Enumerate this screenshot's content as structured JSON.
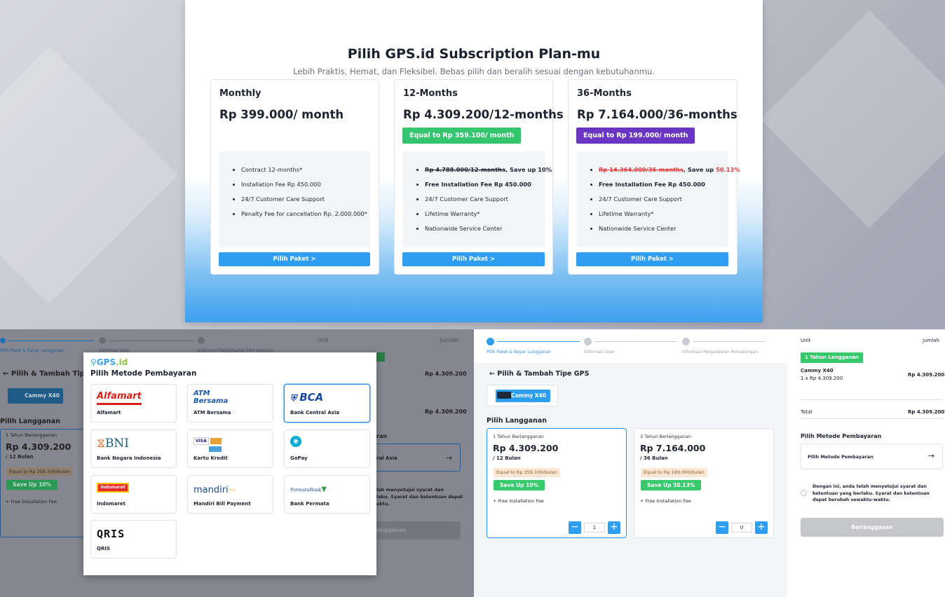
{
  "pricing": {
    "title": "Pilih GPS.id Subscription Plan-mu",
    "subtitle": "Lebih Praktis, Hemat, dan Fleksibel. Bebas pilih dan beralih sesuai dengan kebutuhanmu.",
    "plans": [
      {
        "name": "Monthly",
        "price": "Rp 399.000/ month",
        "equal": "",
        "features": [
          "Contract 12-months*",
          "Installation Fee Rp 450.000",
          "24/7 Customer Care Support",
          "Penalty Fee for cancellation Rp. 2.000.000*"
        ],
        "button": "Pilih Paket >"
      },
      {
        "name": "12-Months",
        "price": "Rp 4.309.200/12-months",
        "equal": "Equal to Rp 359.100/ month",
        "equal_color": "#35c56e",
        "old_price": "Rp 4.788.000/12-months",
        "save": ", Save up 10%",
        "features": [
          "Free Installation Fee Rp 450.000",
          "24/7 Customer Care Support",
          "Lifetime Warranty*",
          "Nationwide Service Center"
        ],
        "button": "Pilih Paket >"
      },
      {
        "name": "36-Months",
        "price": "Rp 7.164.000/36-months",
        "equal": "Equal to Rp 199.000/ month",
        "equal_color": "#6a35c0",
        "old_price": "Rp 14.364.000/36-months",
        "save_prefix": ", Save up ",
        "save_pct": "50.13%",
        "features": [
          "Free Installation Fee Rp 450.000",
          "24/7 Customer Care Support",
          "Lifetime Warranty*",
          "Nationwide Service Center"
        ],
        "button": "Pilih Paket >"
      }
    ]
  },
  "dim_checkout": {
    "step1": "Pilih Paket & Bayar Langganan",
    "step2": "Informasi User",
    "step3": "Informasi Penjadwalan Pemasangan",
    "back_title": "Pilih & Tambah Tipe",
    "device": "Cammy X40",
    "section": "Pilih Langganan",
    "sub_title": "1 Tahun Berlangganan",
    "sub_price": "Rp 4.309.200",
    "sub_unit": "/ 12 Bulan",
    "sub_equal": "Equal to Rp 359.100/bulan",
    "sub_save": "Save Up 10%",
    "sub_fee": "+ Free Installation Fee",
    "unit": "Unit",
    "jumlah": "Jumlah",
    "amount1": "Rp 4.309.200",
    "amount2": "Rp 4.309.200",
    "method_partial": "ran",
    "method_value": "ral Asia",
    "terms_partial1": "lah menyetujui syarat dan",
    "terms_partial2": "laku. Syarat dan ketentuan dapat",
    "terms_partial3": "aktu.",
    "btn_partial": "angganan"
  },
  "modal": {
    "brand": "GPS",
    "brand_suffix": ".id",
    "title": "Pilih Metode Pembayaran",
    "methods": [
      {
        "logo": "Alfamart",
        "name": "Alfamart"
      },
      {
        "logo": "ATM Bersama",
        "name": "ATM Bersama"
      },
      {
        "logo": "BCA",
        "name": "Bank Central Asia"
      },
      {
        "logo": "BNI",
        "name": "Bank Negara Indonesia"
      },
      {
        "logo": "VISA",
        "name": "Kartu Kredit"
      },
      {
        "logo": "gopay-icon",
        "name": "GoPay"
      },
      {
        "logo": "Indomaret",
        "name": "Indomaret"
      },
      {
        "logo": "mandiri",
        "name": "Mandiri Bill Payment"
      },
      {
        "logo": "PermataBank",
        "name": "Bank Permata"
      },
      {
        "logo": "QRIS",
        "name": "QRIS"
      }
    ],
    "selected": "Bank Central Asia"
  },
  "checkout": {
    "step1": "Pilih Paket & Bayar Langganan",
    "step2": "Informasi User",
    "step3": "Informasi Penjadwalan Pemasangan",
    "back_title": "Pilih & Tambah Tipe GPS",
    "device": "Cammy X40",
    "section": "Pilih Langganan",
    "plans": [
      {
        "title": "1 Tahun Berlangganan",
        "price": "Rp 4.309.200",
        "unit": "/ 12 Bulan",
        "equal": "Equal to Rp 359.100/bulan",
        "save": "Save Up 10%",
        "fee": "+ Free Installation Fee",
        "qty": "1"
      },
      {
        "title": "3 Tahun Berlangganan",
        "price": "Rp 7.164.000",
        "unit": "/ 36 Bulan",
        "equal": "Equal to Rp 199.000/bulan",
        "save": "Save Up 50.13%",
        "fee": "+ Free Installation Fee",
        "qty": "0"
      }
    ],
    "summary": {
      "unit": "Unit",
      "jumlah": "Jumlah",
      "badge": "1 Tahun Langganan",
      "item_name": "Cammy X40",
      "item_qty": "1 x Rp 4.309.200",
      "item_amount": "Rp 4.309.200",
      "total_label": "Total",
      "total_amount": "Rp 4.309.200",
      "method_title": "Pilih Metode Pembayaran",
      "method_value": "Pilih Metode Pembayaran",
      "terms": "Dengan ini, anda telah menyetujui syarat dan ketentuan yang berlaku. Syarat dan ketentuan dapat berubah sewaktu-waktu.",
      "submit": "Berlangganan"
    }
  }
}
